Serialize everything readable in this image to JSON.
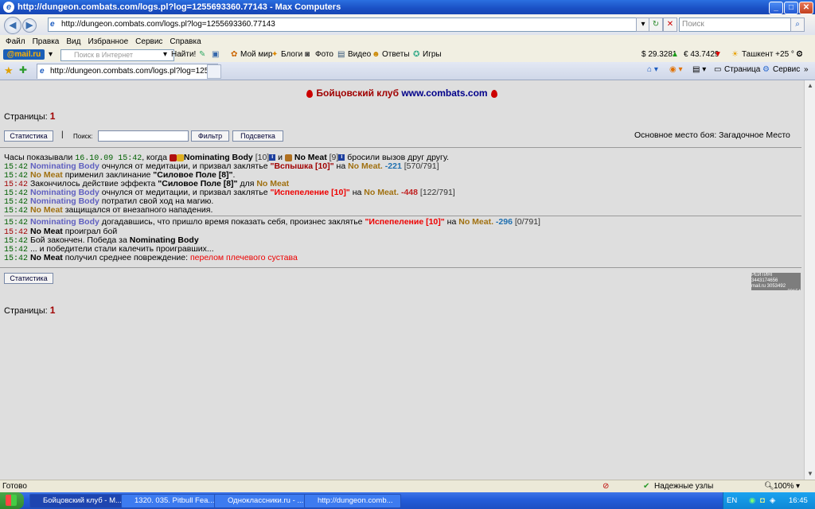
{
  "window": {
    "title": "http://dungeon.combats.com/logs.pl?log=1255693360.77143 - Max Computers",
    "btn_min": "_",
    "btn_max": "□",
    "btn_close": "✕"
  },
  "address": {
    "url": "http://dungeon.combats.com/logs.pl?log=1255693360.77143",
    "search_placeholder": "Поиск"
  },
  "menu": [
    "Файл",
    "Правка",
    "Вид",
    "Избранное",
    "Сервис",
    "Справка"
  ],
  "mailbar": {
    "logo": "@mail.ru",
    "search_placeholder": "Поиск в Интернет",
    "find": "Найти!",
    "links": [
      "Мой мир",
      "Блоги",
      "Фото",
      "Видео",
      "Ответы",
      "Игры"
    ],
    "usd": "$ 29.3281",
    "eur": "€ 43.7429",
    "weather": "Ташкент +25 ° С"
  },
  "tabs": {
    "active": "http://dungeon.combats.com/logs.pl?log=125569336...",
    "page_menu": "Страница",
    "service_menu": "Сервис"
  },
  "page": {
    "header_title": "Бойцовский клуб",
    "header_link": "www.combats.com",
    "pages_label": "Страницы:",
    "pages_num": "1",
    "stats_button": "Статистика",
    "search_label": "Поиск:",
    "filter_button": "Фильтр",
    "highlight_button": "Подсветка",
    "location": "Основное место боя: Загадочное Место",
    "counter_lines": [
      "РЕЙТИНГ 3443174656",
      "mail.ru 3053492",
      "33154"
    ]
  },
  "log": {
    "intro": {
      "a": "Часы показывали",
      "time": "16.10.09 15:42",
      "b": ", когда",
      "p1": "Nominating Body",
      "p1lvl": "[10]",
      "and": "и",
      "p2": "No Meat",
      "p2lvl": "[9]",
      "c": "бросили вызов друг другу."
    },
    "l1": {
      "time": "15:42",
      "who": "Nominating Body",
      "t1": "очнулся от медитации, и призвал заклятье",
      "spell": "\"Вспышка [10]\"",
      "t2": "на",
      "target": "No Meat.",
      "dmg": "-221",
      "hp": "[570/791]"
    },
    "l2": {
      "time": "15:42",
      "who": "No Meat",
      "t1": "применил заклинание",
      "spell": "\"Силовое Поле [8]\"",
      "t2": "."
    },
    "l3": {
      "time": "15:42",
      "t1": "Закончилось действие эффекта",
      "spell": "\"Силовое Поле [8]\"",
      "t2": "для",
      "target": "No Meat"
    },
    "l4": {
      "time": "15:42",
      "who": "Nominating Body",
      "t1": "очнулся от медитации, и призвал заклятье",
      "spell": "\"Испепеление [10]\"",
      "t2": "на",
      "target": "No Meat.",
      "dmg": "-448",
      "hp": "[122/791]"
    },
    "l5": {
      "time": "15:42",
      "who": "Nominating Body",
      "t1": "потратил свой ход на магию."
    },
    "l6": {
      "time": "15:42",
      "who": "No Meat",
      "t1": "защищался от внезапного нападения."
    },
    "l7": {
      "time": "15:42",
      "who": "Nominating Body",
      "t1": "догадавшись, что пришло время показать себя, произнес заклятье",
      "spell": "\"Испепеление [10]\"",
      "t2": "на",
      "target": "No Meat.",
      "dmg": "-296",
      "hp": "[0/791]"
    },
    "l8": {
      "time": "15:42",
      "who": "No Meat",
      "t1": "проиграл бой"
    },
    "l9": {
      "time": "15:42",
      "t1": "Бой закончен. Победа за",
      "who": "Nominating Body"
    },
    "l10": {
      "time": "15:42",
      "t1": "... и победители стали калечить проигравших..."
    },
    "l11": {
      "time": "15:42",
      "who": "No Meat",
      "t1": "получил среднее повреждение:",
      "injury": "перелом плечевого сустава"
    }
  },
  "status": {
    "ready": "Готово",
    "zone": "Надежные узлы",
    "zoom": "100%"
  },
  "taskbar": {
    "tasks": [
      "Бойцовский клуб - М...",
      "1320. 035. Pitbull Fea...",
      "Одноклассники.ru - ...",
      "http://dungeon.comb..."
    ],
    "lang": "EN",
    "clock": "16:45"
  }
}
